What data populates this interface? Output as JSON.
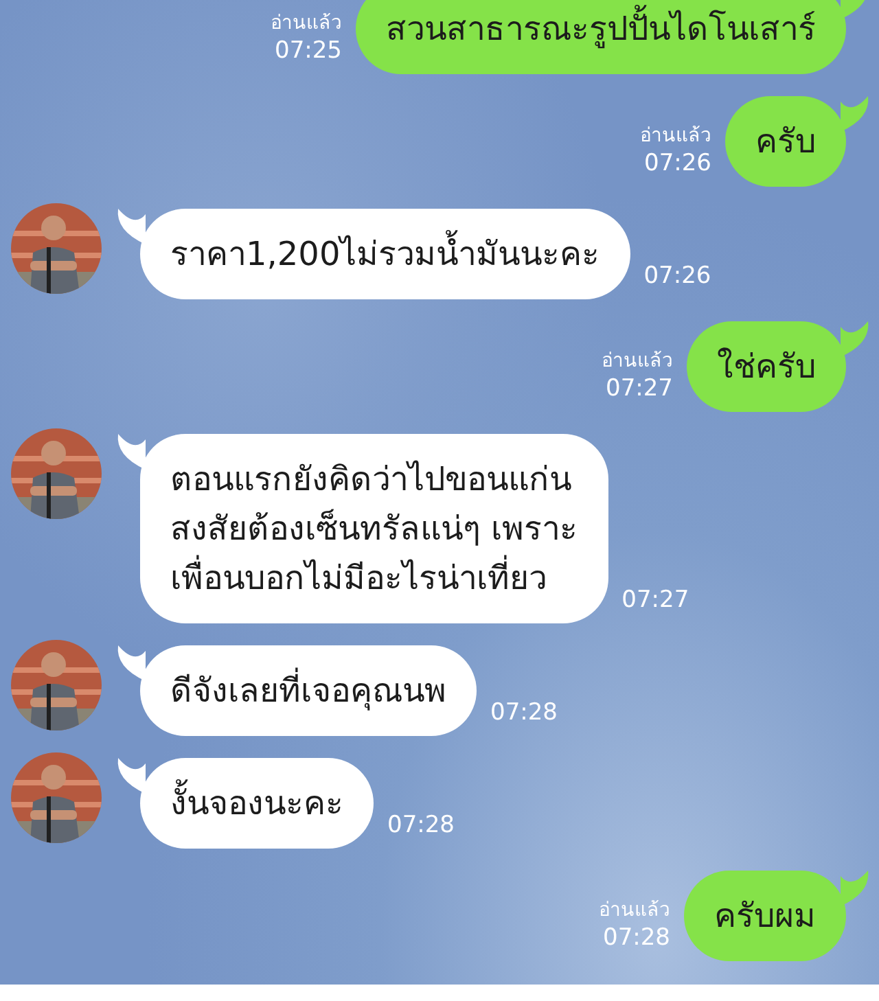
{
  "messages": [
    {
      "kind": "sent",
      "text": "สวนสาธารณะรูปปั้นไดโนเสาร์",
      "read": "อ่านแล้ว",
      "time": "07:25"
    },
    {
      "kind": "sent",
      "text": "ครับ",
      "read": "อ่านแล้ว",
      "time": "07:26"
    },
    {
      "kind": "received",
      "text": "ราคา1,200ไม่รวมน้ำมันนะคะ",
      "time": "07:26"
    },
    {
      "kind": "sent",
      "text": "ใช่ครับ",
      "read": "อ่านแล้ว",
      "time": "07:27"
    },
    {
      "kind": "received",
      "text": "ตอนแรกยังคิดว่าไปขอนแก่น\nสงสัยต้องเซ็นทรัลแน่ๆ เพราะ\nเพื่อนบอกไม่มีอะไรน่าเที่ยว",
      "time": "07:27"
    },
    {
      "kind": "received",
      "text": "ดีจังเลยที่เจอคุณนพ",
      "time": "07:28"
    },
    {
      "kind": "received",
      "text": "งั้นจองนะคะ",
      "time": "07:28"
    },
    {
      "kind": "sent",
      "text": "ครับผม",
      "read": "อ่านแล้ว",
      "time": "07:28"
    }
  ]
}
